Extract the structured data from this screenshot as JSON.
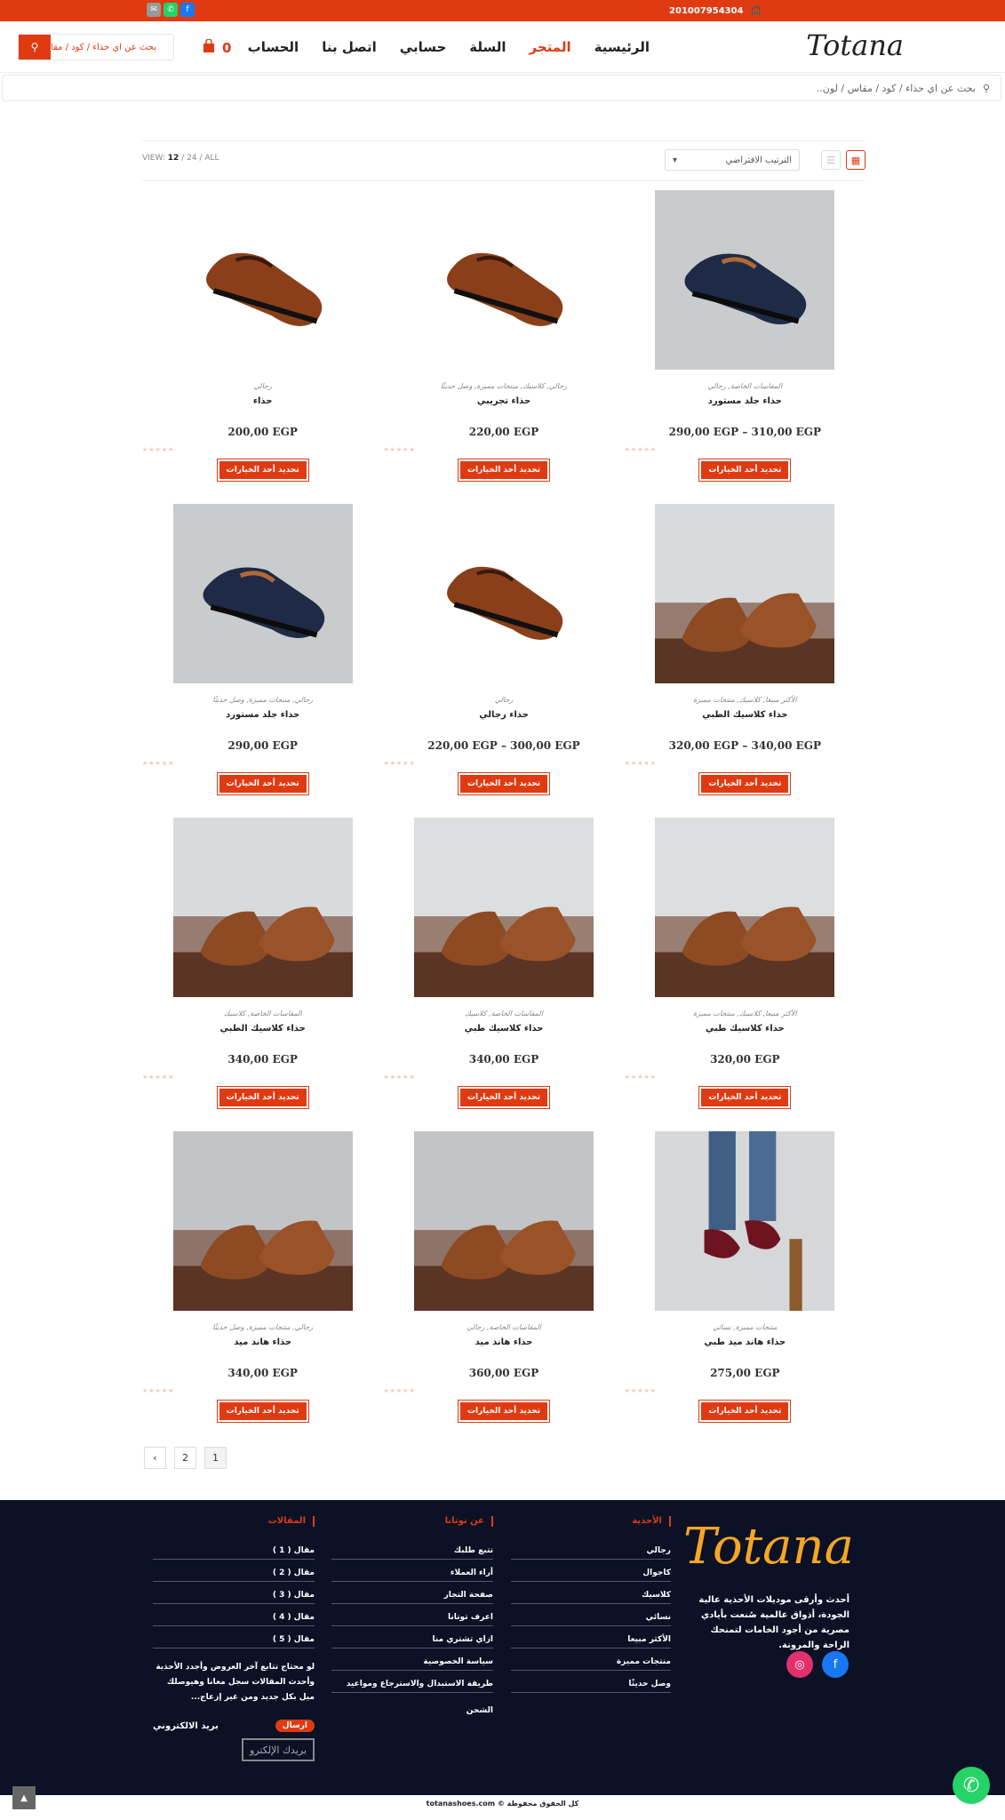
{
  "colors": {
    "accent": "#e03a12",
    "footer_bg": "#0c1126",
    "logo_footer": "#f5a623"
  },
  "topbar": {
    "phone": "201007954304",
    "phone_icon": "headset-icon",
    "socials": [
      "email-icon",
      "whatsapp-icon",
      "facebook-icon"
    ]
  },
  "header": {
    "logo": "Totana",
    "nav": [
      "الرئيسية",
      "المتجر",
      "السلة",
      "حسابي",
      "اتصل بنا",
      "الحساب"
    ],
    "active_nav": "المتجر",
    "cart_count": "0",
    "search_placeholder": "بحث عن اي حذاء / كود / مقا"
  },
  "search": {
    "placeholder": "بحث عن اي حذاء / كود / مقاس / لون.."
  },
  "toolbar": {
    "sort": "الترتيب الافتراضي",
    "view_label": "VIEW:",
    "view_12": "12",
    "view_24": "24",
    "view_all": "ALL",
    "sep": "/"
  },
  "products": [
    {
      "name": "حذاء",
      "cats": "رجالي",
      "price": "200,00 EGP",
      "button": "تحديد أحد الخيارات",
      "image": "brown-loafer"
    },
    {
      "name": "حذاء تجريبي",
      "cats": "رجالي, كلاسيك, منتجات مميزة, وصل حديثًا",
      "price": "220,00 EGP",
      "button": "تحديد أحد الخيارات",
      "image": "brown-loafer"
    },
    {
      "name": "حذاء جلد مستورد",
      "cats": "المقاسات الخاصة, رجالي",
      "price": "290,00 EGP – 310,00 EGP",
      "button": "تحديد أحد الخيارات",
      "image": "navy-loafer"
    },
    {
      "name": "حذاء جلد مستورد",
      "cats": "رجالي, منتجات مميزة, وصل حديثًا",
      "price": "290,00 EGP",
      "button": "تحديد أحد الخيارات",
      "image": "navy-loafer"
    },
    {
      "name": "حذاء رجالي",
      "cats": "رجالي",
      "price": "220,00 EGP – 300,00 EGP",
      "button": "تحديد أحد الخيارات",
      "image": "brown-loafer"
    },
    {
      "name": "حذاء كلاسيك الطبي",
      "cats": "الأكثر مبيعا, كلاسيك, منتجات مميزة",
      "price": "320,00 EGP – 340,00 EGP",
      "button": "تحديد أحد الخيارات",
      "image": "brogue-pair"
    },
    {
      "name": "حذاء كلاسيك الطبي",
      "cats": "المقاسات الخاصة, كلاسيك",
      "price": "340,00 EGP",
      "button": "تحديد أحد الخيارات",
      "image": "brogue-pair"
    },
    {
      "name": "حذاء كلاسيك طبي",
      "cats": "المقاسات الخاصة, كلاسيك",
      "price": "340,00 EGP",
      "button": "تحديد أحد الخيارات",
      "image": "tassel-pair"
    },
    {
      "name": "حذاء كلاسيك طبي",
      "cats": "الأكثر مبيعا, كلاسيك, منتجات مميزة",
      "price": "320,00 EGP",
      "button": "تحديد أحد الخيارات",
      "image": "tassel-pair"
    },
    {
      "name": "حذاء هاند ميد",
      "cats": "رجالي, منتجات مميزة, وصل حديثًا",
      "price": "340,00 EGP",
      "button": "تحديد أحد الخيارات",
      "image": "handmade-pair"
    },
    {
      "name": "حذاء هاند ميد",
      "cats": "المقاسات الخاصة, رجالي",
      "price": "360,00 EGP",
      "button": "تحديد أحد الخيارات",
      "image": "handmade-pair"
    },
    {
      "name": "حذاء هاند ميد طبي",
      "cats": "منتجات مميزة, نسائي",
      "price": "275,00 EGP",
      "button": "تحديد أحد الخيارات",
      "image": "women-flats"
    }
  ],
  "pagination": [
    "1",
    "2",
    "next-icon"
  ],
  "footer": {
    "logo": "Totana",
    "description": "أحدث وأرقى موديلات الأحذية عالية الجودة، أذواق عالمية صُنعت بأيادي مصرية من أجود الخامات لتمنحك الراحة والمرونة.",
    "col1": {
      "title": "الأحذية",
      "items": [
        "رجالي",
        "كاجوال",
        "كلاسيك",
        "نسائي",
        "الأكثر مبيعا",
        "منتجات مميزة",
        "وصل حديثًا"
      ]
    },
    "col2": {
      "title": "عن توتانا",
      "items": [
        "تتبع طلبك",
        "أراء العملاء",
        "صفحة التجار",
        "اعرف توتانا",
        "ازاي تشتري منا",
        "سياسة الخصوصية",
        "طريقة الاستبدال والاسترجاع ومواعيد الشحن"
      ]
    },
    "col3": {
      "title": "المقالات",
      "items": [
        "مقال ( 1 )",
        "مقال ( 2 )",
        "مقال ( 3 )",
        "مقال ( 4 )",
        "مقال ( 5 )"
      ]
    },
    "note": "لو محتاج تتابع آخر العروض وأجدد الأحذية وأحدث المقالات سجل معانا وهيوصلك ميل بكل جديد ومن غير إزعاج...",
    "email_label": "بريد الالكتروني",
    "send_label": "ارسال",
    "email_placeholder": "بريدك الإلكترو"
  },
  "copyright": "كل الحقوق محفوظة © totanashoes.com"
}
